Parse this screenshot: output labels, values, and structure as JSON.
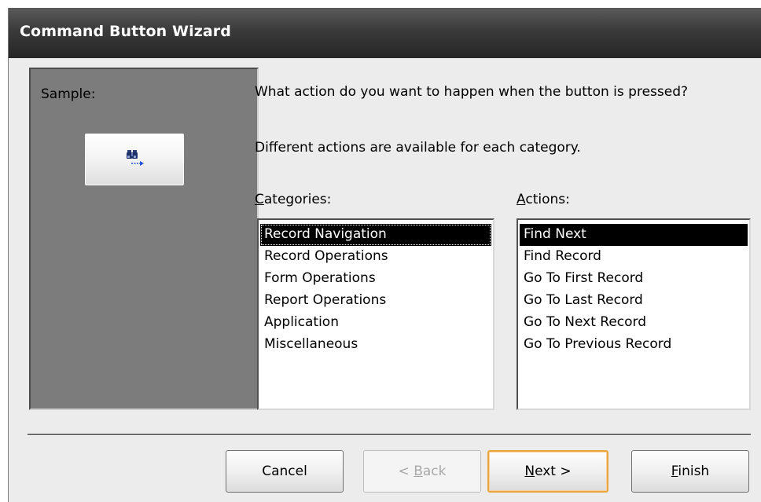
{
  "window": {
    "title": "Command Button Wizard"
  },
  "sample": {
    "label": "Sample:",
    "icon": "binoculars-find-next-icon"
  },
  "question": "What action do you want to happen when the button is pressed?",
  "info": "Different actions are available for each category.",
  "categories": {
    "label_mnemonic": "C",
    "label_rest": "ategories:",
    "items": [
      "Record Navigation",
      "Record Operations",
      "Form Operations",
      "Report Operations",
      "Application",
      "Miscellaneous"
    ],
    "selected": "Record Navigation"
  },
  "actions": {
    "label_mnemonic": "A",
    "label_rest": "ctions:",
    "items": [
      "Find Next",
      "Find Record",
      "Go To First Record",
      "Go To Last Record",
      "Go To Next Record",
      "Go To Previous Record"
    ],
    "selected": "Find Next"
  },
  "buttons": {
    "cancel": "Cancel",
    "back_pre": "< ",
    "back_mnemonic": "B",
    "back_rest": "ack",
    "next_mnemonic": "N",
    "next_rest": "ext >",
    "finish_mnemonic": "F",
    "finish_rest": "inish"
  },
  "colors": {
    "title_bar": "#2f2f2f",
    "sample_panel": "#7c7c7c",
    "default_button_border": "#e8a640",
    "selection": "#000000"
  }
}
